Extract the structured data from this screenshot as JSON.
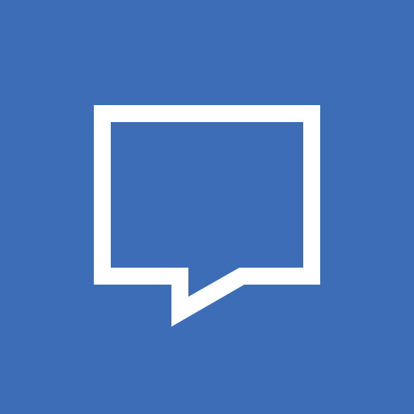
{
  "app": {
    "icon": "chat-bubble-icon",
    "colors": {
      "background": "#3E6DB8",
      "foreground": "#FFFFFF"
    }
  }
}
